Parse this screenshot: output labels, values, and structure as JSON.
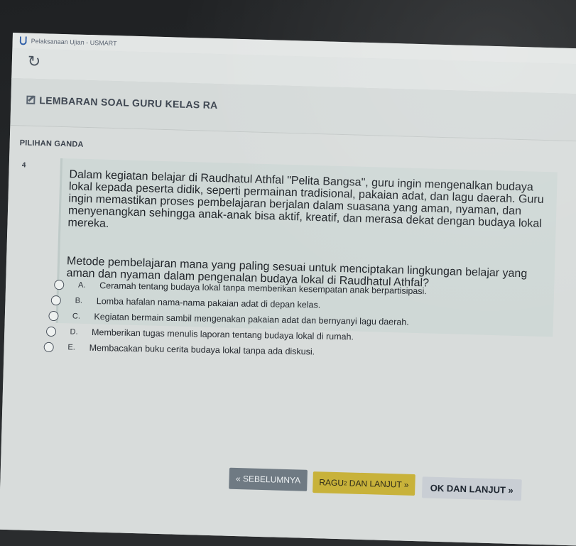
{
  "window": {
    "title": "Pelaksanaan Ujian - USMART"
  },
  "toolbar": {
    "reload_icon": "reload-icon"
  },
  "header": {
    "title": "LEMBARAN SOAL GURU KELAS RA",
    "icon": "edit-icon"
  },
  "question": {
    "type": "PILIHAN GANDA",
    "number": "4",
    "text": "Dalam kegiatan belajar di Raudhatul Athfal \"Pelita Bangsa\", guru ingin mengenalkan budaya lokal kepada peserta didik, seperti permainan tradisional, pakaian adat, dan lagu daerah. Guru ingin memastikan proses pembelajaran berjalan dalam suasana yang aman, nyaman, dan menyenangkan sehingga anak-anak bisa aktif, kreatif, dan merasa dekat dengan budaya lokal mereka.",
    "prompt": "Metode pembelajaran mana yang paling sesuai untuk menciptakan lingkungan belajar yang aman dan nyaman dalam pengenalan budaya lokal di Raudhatul Athfal?",
    "options": [
      {
        "letter": "A.",
        "text": "Ceramah tentang budaya lokal tanpa memberikan kesempatan anak berpartisipasi."
      },
      {
        "letter": "B.",
        "text": "Lomba hafalan nama-nama pakaian adat di depan kelas."
      },
      {
        "letter": "C.",
        "text": "Kegiatan bermain sambil mengenakan pakaian adat dan bernyanyi lagu daerah."
      },
      {
        "letter": "D.",
        "text": "Memberikan tugas menulis laporan tentang budaya lokal di rumah."
      },
      {
        "letter": "E.",
        "text": "Membacakan buku cerita budaya lokal tanpa ada diskusi."
      }
    ]
  },
  "navigation": {
    "prev_label": "« SEBELUMNYA",
    "ragu_label": "RAGU",
    "ragu_sup": "2",
    "ragu_suffix": " DAN LANJUT »",
    "ok_label": "OK DAN LANJUT »"
  },
  "colors": {
    "prev_button": "#6f7a83",
    "ragu_button": "#c8b23a",
    "ok_button": "#c9ced4",
    "question_panel": "#cfd8d6"
  }
}
